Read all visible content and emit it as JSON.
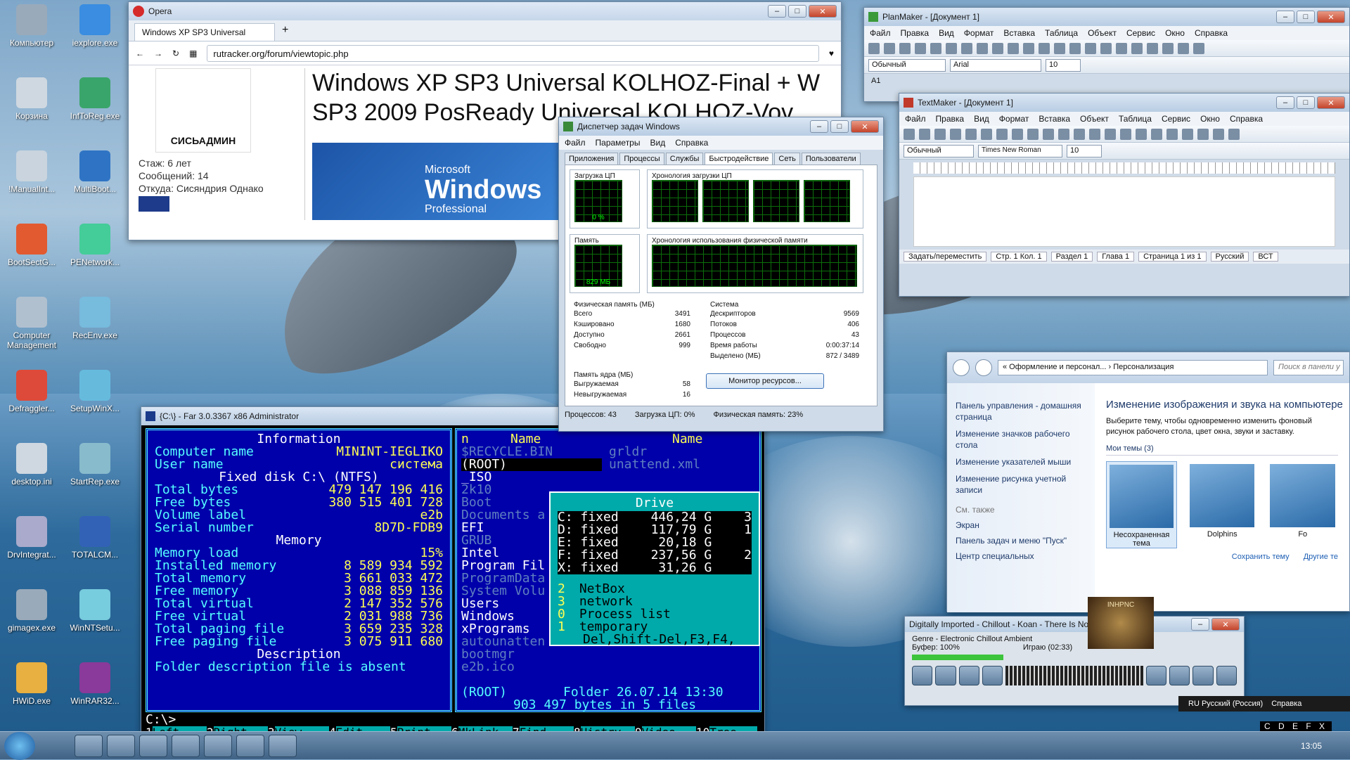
{
  "desktop": {
    "icons": [
      "Компьютер",
      "iexplore.exe",
      "Корзина",
      "InfToReg.exe",
      "!ManualInt...",
      "MultiBoot...",
      "BootSectG...",
      "PENetwork...",
      "Computer Management",
      "RecEnv.exe",
      "Defraggler...",
      "SetupWinX...",
      "desktop.ini",
      "StartRep.exe",
      "DrvIntegrat...",
      "TOTALCM...",
      "gimagex.exe",
      "WinNTSetu...",
      "HWiD.exe",
      "WinRAR32..."
    ]
  },
  "opera": {
    "title": "Opera",
    "tab": "Windows XP SP3 Universal",
    "url": "rutracker.org/forum/viewtopic.php",
    "heading": "Windows XP SP3 Universal KOLHOZ-Final + W SP3 2009 PosReady Universal KOLHOZ-Vov",
    "avatar_caption": "СИСЬАДМИН",
    "stats": [
      "Стаж: 6 лет",
      "Сообщений: 14",
      "Откуда: Сисяндрия Однако"
    ],
    "logo_ms": "Microsoft",
    "logo_win": "Windows",
    "logo_pro": "Professional"
  },
  "taskmgr": {
    "title": "Диспетчер задач Windows",
    "menu": [
      "Файл",
      "Параметры",
      "Вид",
      "Справка"
    ],
    "tabs": [
      "Приложения",
      "Процессы",
      "Службы",
      "Быстродействие",
      "Сеть",
      "Пользователи"
    ],
    "cpu_label": "Загрузка ЦП",
    "cpu_val": "0 %",
    "cpu_hist": "Хронология загрузки ЦП",
    "mem_label": "Память",
    "mem_val": "829 МБ",
    "mem_hist": "Хронология использования физической памяти",
    "phys_title": "Физическая память (МБ)",
    "phys": [
      [
        "Всего",
        "3491"
      ],
      [
        "Кэшировано",
        "1680"
      ],
      [
        "Доступно",
        "2661"
      ],
      [
        "Свободно",
        "999"
      ]
    ],
    "sys_title": "Система",
    "sys": [
      [
        "Дескрипторов",
        "9569"
      ],
      [
        "Потоков",
        "406"
      ],
      [
        "Процессов",
        "43"
      ],
      [
        "Время работы",
        "0:00:37:14"
      ],
      [
        "Выделено (МБ)",
        "872 / 3489"
      ]
    ],
    "kernel_title": "Память ядра (МБ)",
    "kernel": [
      [
        "Выгружаемая",
        "58"
      ],
      [
        "Невыгружаемая",
        "16"
      ]
    ],
    "resmon": "Монитор ресурсов...",
    "status": [
      "Процессов: 43",
      "Загрузка ЦП: 0%",
      "Физическая память: 23%"
    ]
  },
  "planmaker": {
    "title": "PlanMaker - [Документ 1]",
    "menu": [
      "Файл",
      "Правка",
      "Вид",
      "Формат",
      "Вставка",
      "Таблица",
      "Объект",
      "Сервис",
      "Окно",
      "Справка"
    ],
    "style": "Обычный",
    "font": "Arial",
    "size": "10",
    "cell": "A1"
  },
  "textmaker": {
    "title": "TextMaker - [Документ 1]",
    "menu": [
      "Файл",
      "Правка",
      "Вид",
      "Формат",
      "Вставка",
      "Объект",
      "Таблица",
      "Сервис",
      "Окно",
      "Справка"
    ],
    "style": "Обычный",
    "font": "Times New Roman",
    "size": "10",
    "status": [
      "Задать/переместить",
      "Стр. 1 Кол. 1",
      "Раздел 1",
      "Глава 1",
      "Страница 1 из 1",
      "Русский",
      "ВСТ"
    ]
  },
  "personal": {
    "breadcrumb": "« Оформление и персонал... › Персонализация",
    "search": "Поиск в панели у",
    "links": [
      "Панель управления - домашняя страница",
      "Изменение значков рабочего стола",
      "Изменение указателей мыши",
      "Изменение рисунка учетной записи"
    ],
    "see_also": "См. также",
    "see_links": [
      "Экран",
      "Панель задач и меню \"Пуск\"",
      "Центр специальных"
    ],
    "heading": "Изменение изображения и звука на компьютере",
    "desc": "Выберите тему, чтобы одновременно изменить фоновый рисунок рабочего стола, цвет окна, звуки и заставку.",
    "my_themes": "Мои темы (3)",
    "themes": [
      "Несохраненная тема",
      "Dolphins",
      "Fo"
    ],
    "save_link": "Сохранить тему",
    "other_link": "Другие те"
  },
  "player": {
    "title": "Digitally Imported - Chillout - Koan - There Is No...",
    "genre": "Genre - Electronic Chillout Ambient",
    "buffer": "Буфер: 100%",
    "playing": "Играю (02:33)",
    "art": "INHPNC"
  },
  "far": {
    "title": "{C:\\} - Far 3.0.3367 x86 Administrator",
    "info": "Information",
    "comp_l": "Computer name",
    "comp_v": "MININT-IEGLIKO",
    "user_l": "User name",
    "user_v": "система",
    "disk": "Fixed disk C:\\ (NTFS)",
    "tb_l": "Total bytes",
    "tb_v": "479 147 196 416",
    "fb_l": "Free bytes",
    "fb_v": "380 515 401 728",
    "vl_l": "Volume label",
    "vl_v": "e2b",
    "sn_l": "Serial number",
    "sn_v": "8D7D-FDB9",
    "memory": "Memory",
    "mem_rows": [
      [
        "Memory load",
        "15%"
      ],
      [
        "Installed memory",
        "8 589 934 592"
      ],
      [
        "Total memory",
        "3 661 033 472"
      ],
      [
        "Free memory",
        "3 088 859 136"
      ],
      [
        "Total virtual",
        "2 147 352 576"
      ],
      [
        "Free virtual",
        "2 031 988 736"
      ],
      [
        "Total paging file",
        "3 659 235 328"
      ],
      [
        "Free paging file",
        "3 075 911 680"
      ]
    ],
    "desc": "Description",
    "desc_text": "Folder description file is absent",
    "col_n": "n",
    "col_name": "Name",
    "col_name2": "Name",
    "files": [
      "$RECYCLE.BIN",
      "(ROOT)",
      "_ISO",
      "2k10",
      "Boot",
      "Documents a",
      "EFI",
      "GRUB",
      "Intel",
      "Program Fil",
      "ProgramData",
      "System Volu",
      "Users",
      "Windows",
      "xPrograms",
      "autounatten",
      "bootmgr",
      "e2b.ico"
    ],
    "files2": [
      "grldr",
      "unattend.xml"
    ],
    "drive_title": "Drive",
    "drives": [
      [
        "C: fixed",
        "446,24 G",
        "3"
      ],
      [
        "D: fixed",
        "117,79 G",
        "1"
      ],
      [
        "E: fixed",
        "20,18 G",
        ""
      ],
      [
        "F: fixed",
        "237,56 G",
        "2"
      ],
      [
        "X: fixed",
        "31,26 G",
        ""
      ]
    ],
    "drive_extra": [
      [
        "2",
        "NetBox"
      ],
      [
        "3",
        "network"
      ],
      [
        "0",
        "Process list"
      ],
      [
        "1",
        "temporary"
      ]
    ],
    "drive_hint": "Del,Shift-Del,F3,F4,",
    "root": "(ROOT)",
    "folder": "Folder 26.07.14 13:30",
    "bytes": "903 497 bytes in 5 files",
    "prompt": "C:\\>",
    "keys": [
      [
        "1",
        "Left"
      ],
      [
        "2",
        "Right"
      ],
      [
        "3",
        "View.."
      ],
      [
        "4",
        "Edit.."
      ],
      [
        "5",
        "Print"
      ],
      [
        "6",
        "MkLink"
      ],
      [
        "7",
        "Find"
      ],
      [
        "8",
        "Histry"
      ],
      [
        "9",
        "Video"
      ],
      [
        "10",
        "Tree"
      ]
    ]
  },
  "tray": {
    "lang": "RU Русский (Россия)",
    "help": "Справка",
    "drives": "C D E F X",
    "time": "13:05"
  }
}
